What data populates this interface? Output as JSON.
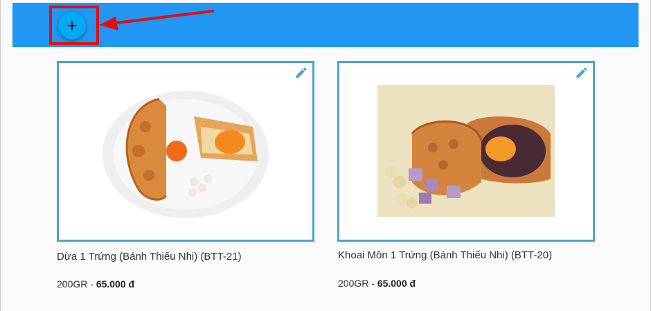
{
  "toolbar": {
    "add_label": "+",
    "accent": "#2196f3",
    "button_color": "#03a9f4",
    "annotation_color": "#e01010"
  },
  "products": [
    {
      "name": "Dừa 1 Trứng (Bánh Thiếu Nhi) (BTT-21)",
      "weight": "200GR",
      "separator": " - ",
      "price": "65.000 đ",
      "edit_icon": "pencil-icon"
    },
    {
      "name": "Khoai Môn 1 Trứng (Bánh Thiếu Nhi) (BTT-20)",
      "weight": "200GR",
      "separator": " - ",
      "price": "65.000 đ",
      "edit_icon": "pencil-icon"
    }
  ],
  "card_border_color": "#4aa3d6"
}
